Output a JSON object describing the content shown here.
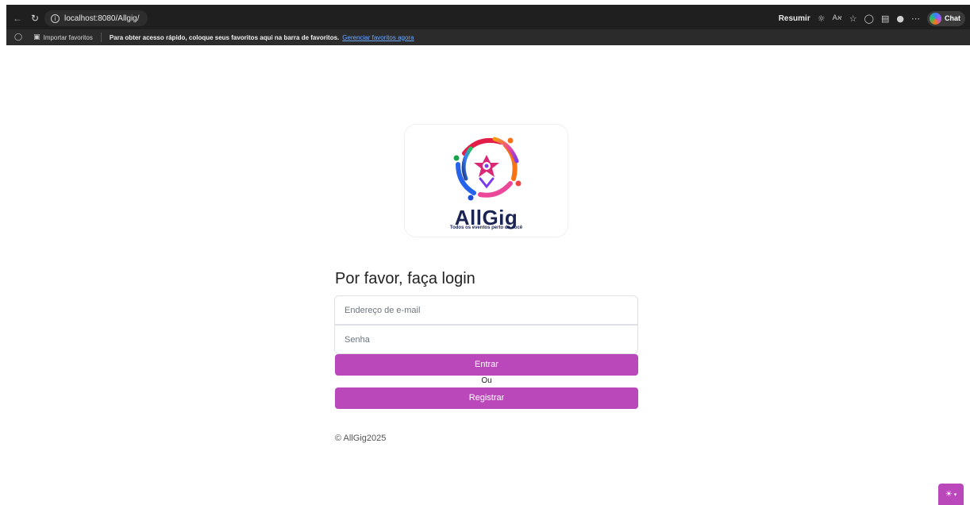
{
  "browser": {
    "url": "localhost:8080/Allgig/",
    "summarize_label": "Resumir",
    "chat_label": "Chat",
    "more_icon": "more-icon"
  },
  "favorites_bar": {
    "import_label": "Importar favoritos",
    "message": "Para obter acesso rápido, coloque seus favoritos aqui na barra de favoritos.",
    "manage_link": "Gerenciar favoritos agora"
  },
  "logo": {
    "brand": "AllGig",
    "tagline": "Todos os eventos perto de você"
  },
  "login": {
    "title": "Por favor, faça login",
    "email_placeholder": "Endereço de e-mail",
    "password_placeholder": "Senha",
    "submit_label": "Entrar",
    "or_label": "Ou",
    "register_label": "Registrar"
  },
  "footer": {
    "copyright": "© AllGig2025"
  },
  "theme_toggle": {
    "icon": "sun-icon"
  },
  "colors": {
    "accent": "#bb48bb",
    "browser_dark": "#1f1f1f",
    "brand_navy": "#1b2452"
  }
}
